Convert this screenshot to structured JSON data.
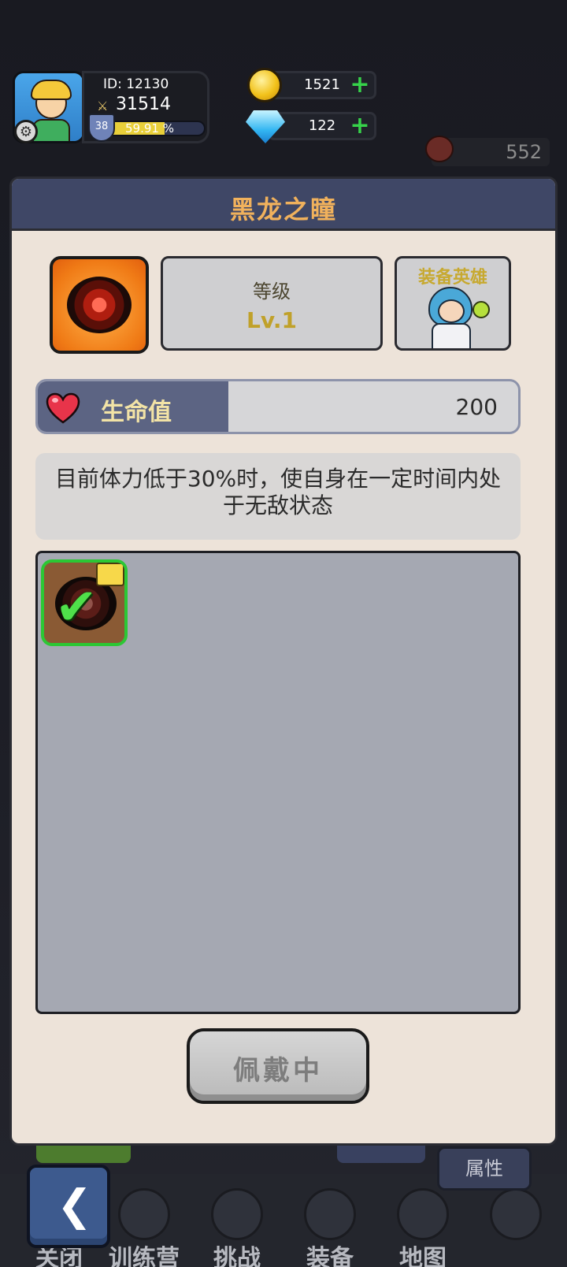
{
  "hud": {
    "player_id": "ID: 12130",
    "power": "31514",
    "level": "38",
    "xp_percent_text": "59.91 %",
    "xp_fraction": 0.5991,
    "coins": "1521",
    "gems": "122",
    "stamina": "552"
  },
  "modal": {
    "title": "黑龙之瞳",
    "level_label": "等级",
    "level_value": "Lv.1",
    "hero_label": "装备英雄",
    "stat_label": "生命值",
    "stat_value": "200",
    "description": "目前体力低于30%时，使自身在一定时间内处于无敌状态",
    "wear_button": "佩戴中"
  },
  "nav": {
    "items": [
      {
        "label": "关闭"
      },
      {
        "label": "训练营"
      },
      {
        "label": "挑战"
      },
      {
        "label": "装备"
      },
      {
        "label": "地图"
      }
    ],
    "attr_tab": "属性"
  },
  "colors": {
    "modal_header": "#3f4766",
    "title_gold": "#f0b15c",
    "equipped_green": "#2cc734"
  }
}
